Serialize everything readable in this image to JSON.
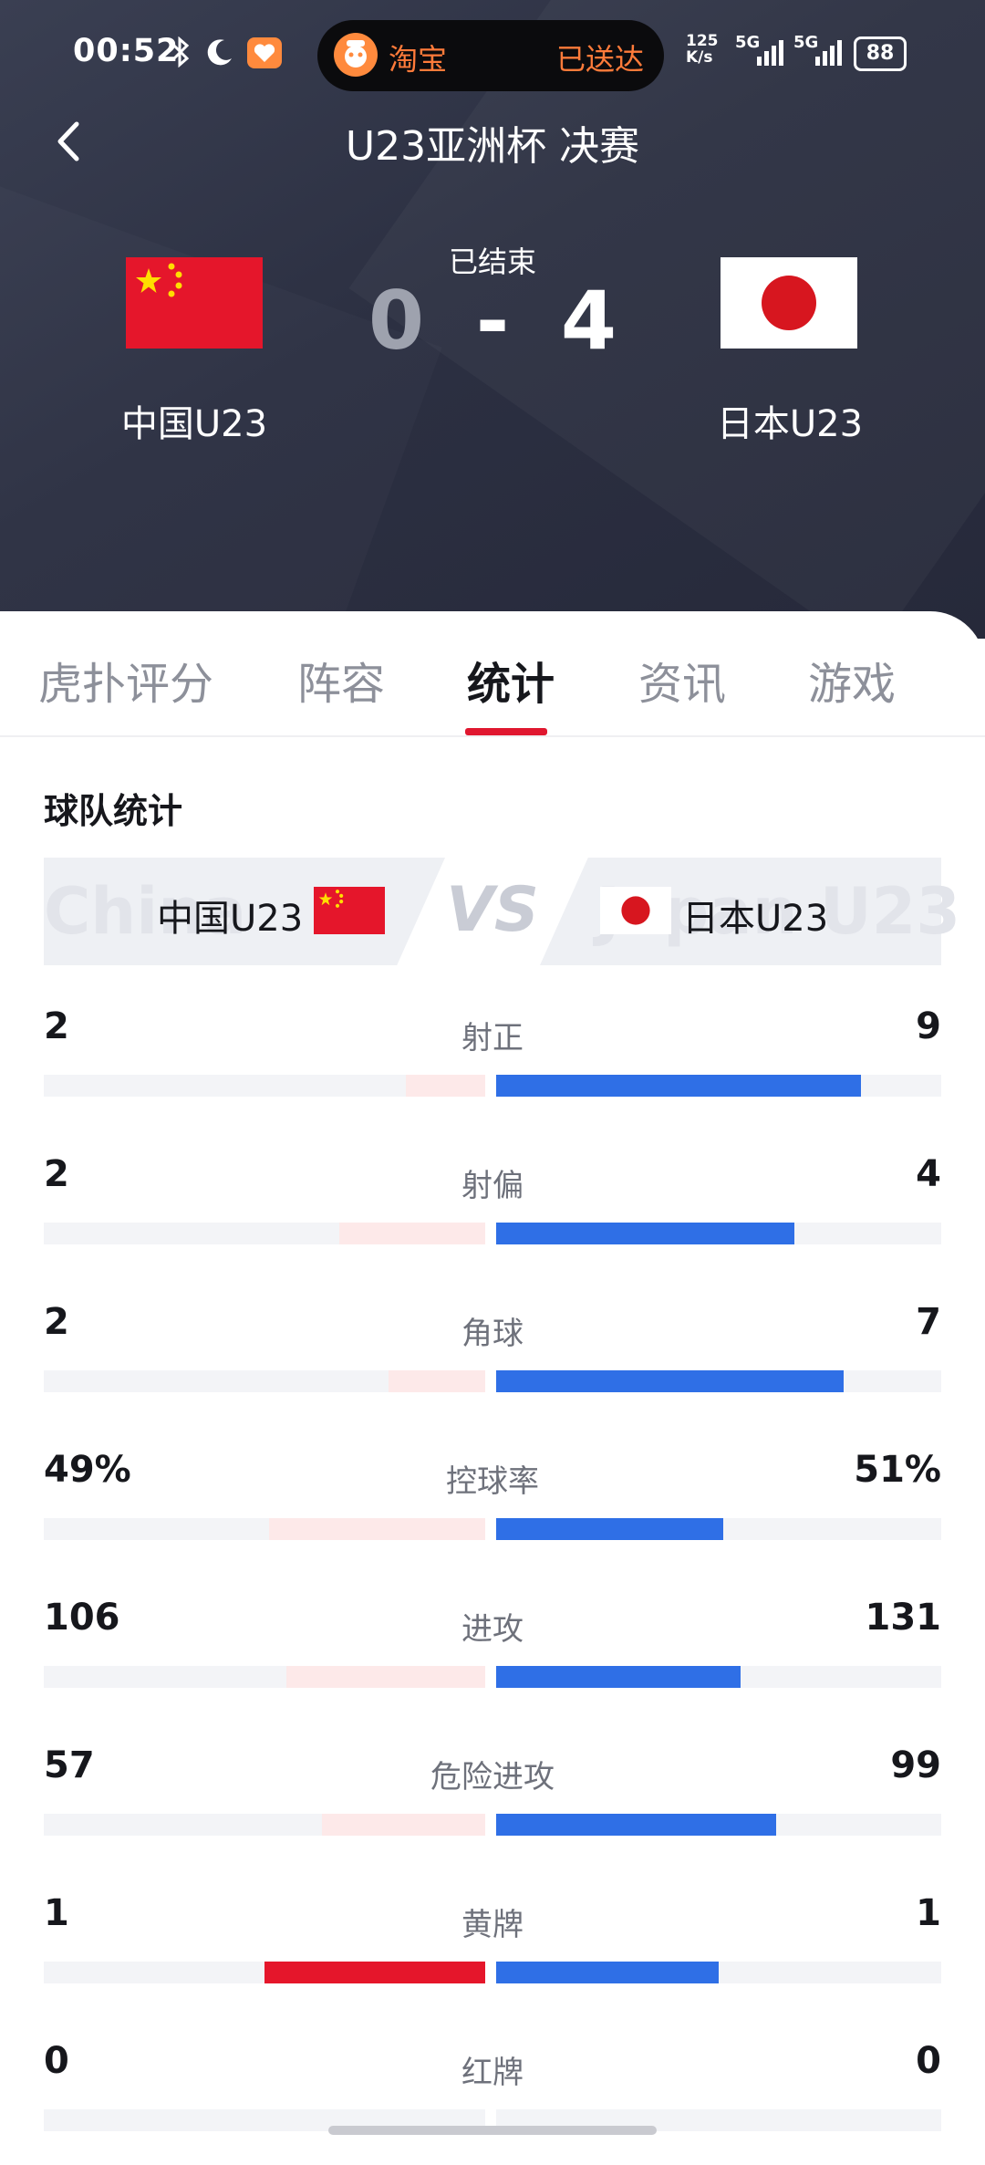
{
  "status_bar": {
    "time": "00:52",
    "island_app": "淘宝",
    "island_status": "已送达",
    "net_speed_top": "125",
    "net_speed_unit": "K/s",
    "sig1": "5G",
    "sig2": "5G",
    "battery": "88"
  },
  "header": {
    "title": "U23亚洲杯 决赛"
  },
  "match": {
    "status": "已结束",
    "home_team": "中国U23",
    "away_team": "日本U23",
    "home_score": "0",
    "separator": "-",
    "away_score": "4"
  },
  "tabs": [
    {
      "label": "虎扑评分",
      "active": false
    },
    {
      "label": "阵容",
      "active": false
    },
    {
      "label": "统计",
      "active": true
    },
    {
      "label": "资讯",
      "active": false
    },
    {
      "label": "游戏",
      "active": false
    }
  ],
  "team_stats": {
    "title": "球队统计",
    "vs_label": "VS",
    "home_ghost": "China",
    "away_ghost": "Japan U23",
    "home_name": "中国U23",
    "away_name": "日本U23",
    "colors": {
      "home": "#e5162b",
      "home_light": "#fde9e9",
      "away": "#2f6fe6"
    },
    "rows": [
      {
        "label": "射正",
        "home": "2",
        "away": "9",
        "home_share": 0.18,
        "away_share": 0.82,
        "home_highlight": false
      },
      {
        "label": "射偏",
        "home": "2",
        "away": "4",
        "home_share": 0.33,
        "away_share": 0.67,
        "home_highlight": false
      },
      {
        "label": "角球",
        "home": "2",
        "away": "7",
        "home_share": 0.22,
        "away_share": 0.78,
        "home_highlight": false
      },
      {
        "label": "控球率",
        "home": "49%",
        "away": "51%",
        "home_share": 0.49,
        "away_share": 0.51,
        "home_highlight": false
      },
      {
        "label": "进攻",
        "home": "106",
        "away": "131",
        "home_share": 0.45,
        "away_share": 0.55,
        "home_highlight": false
      },
      {
        "label": "危险进攻",
        "home": "57",
        "away": "99",
        "home_share": 0.37,
        "away_share": 0.63,
        "home_highlight": false
      },
      {
        "label": "黄牌",
        "home": "1",
        "away": "1",
        "home_share": 0.5,
        "away_share": 0.5,
        "home_highlight": true
      },
      {
        "label": "红牌",
        "home": "0",
        "away": "0",
        "home_share": 0,
        "away_share": 0,
        "home_highlight": false
      }
    ]
  }
}
